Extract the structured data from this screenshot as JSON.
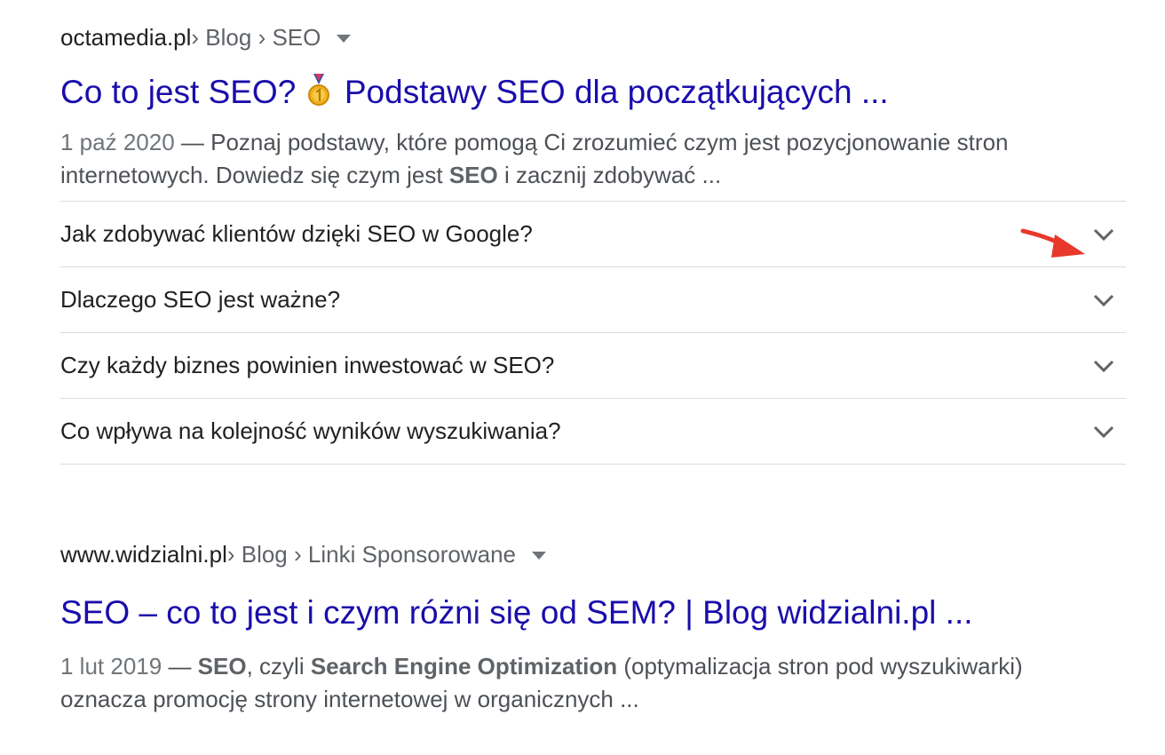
{
  "results": [
    {
      "domain": "octamedia.pl",
      "crumbs": " › Blog › SEO",
      "title_part1": "Co to jest SEO? ",
      "title_emoji": "medal-icon",
      "title_part2": " Podstawy SEO dla początkujących ...",
      "date": "1 paź 2020",
      "dash": " — ",
      "snippet_a": "Poznaj podstawy, które pomogą Ci zrozumieć czym jest pozycjonowanie stron internetowych. Dowiedz się czym jest ",
      "snippet_bold": "SEO",
      "snippet_b": " i zacznij zdobywać ..."
    },
    {
      "domain": "www.widzialni.pl",
      "crumbs": " › Blog › Linki Sponsorowane",
      "title": "SEO – co to jest i czym różni się od SEM? | Blog widzialni.pl ...",
      "date": "1 lut 2019",
      "dash": " — ",
      "snippet_bold1": "SEO",
      "snippet_a": ", czyli ",
      "snippet_bold2": "Search Engine Optimization",
      "snippet_b": " (optymalizacja stron pod wyszukiwarki) oznacza promocję strony internetowej w organicznych ..."
    }
  ],
  "people_also_ask": [
    {
      "question": "Jak zdobywać klientów dzięki SEO w Google?"
    },
    {
      "question": "Dlaczego SEO jest ważne?"
    },
    {
      "question": "Czy każdy biznes powinien inwestować w SEO?"
    },
    {
      "question": "Co wpływa na kolejność wyników wyszukiwania?"
    }
  ],
  "colors": {
    "link": "#1a0dab",
    "text": "#202124",
    "muted": "#70757a",
    "divider": "#dadce0",
    "annotation": "#e8382a",
    "medal_gold": "#f2b01e"
  },
  "icons": {
    "dropdown": "caret-down-icon",
    "expand": "chevron-down-icon",
    "medal": "medal-icon",
    "annotation": "red-arrow-icon"
  }
}
